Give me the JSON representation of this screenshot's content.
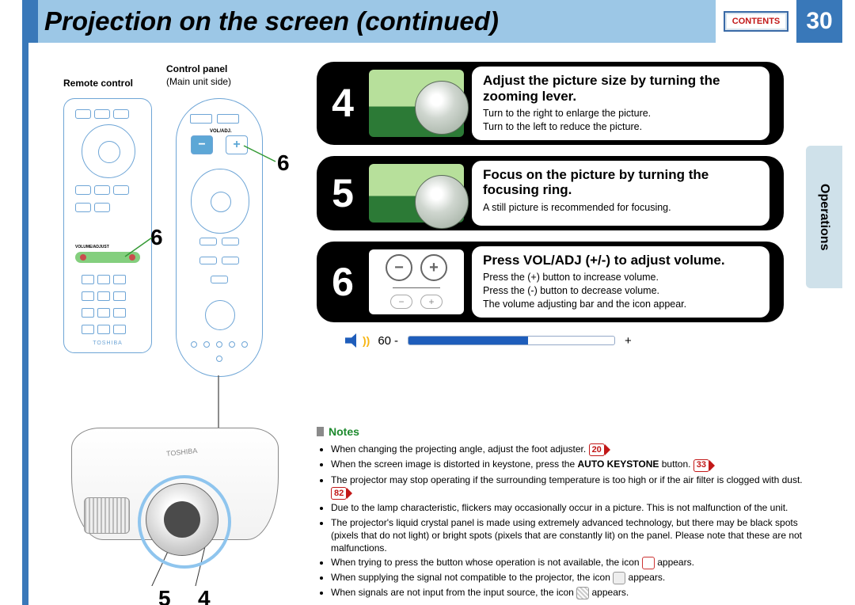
{
  "header": {
    "title": "Projection on the screen (continued)",
    "contents_label": "CONTENTS",
    "page_number": "30"
  },
  "side_tab": "Operations",
  "left": {
    "remote_label": "Remote control",
    "panel_label": "Control panel",
    "panel_sub": "(Main unit side)",
    "logo": "TOSHIBA",
    "voladj_label": "VOLUME/ADJUST",
    "cp_voladj": "VOL/ADJ.",
    "callout_6a": "6",
    "callout_6b": "6",
    "proj_5": "5",
    "proj_4": "4"
  },
  "steps": {
    "s4": {
      "num": "4",
      "title": "Adjust the picture size by turning the zooming lever.",
      "line1": "Turn to the right to enlarge the picture.",
      "line2": "Turn to the left to reduce the picture."
    },
    "s5": {
      "num": "5",
      "title": "Focus on the picture by turning the focusing ring.",
      "line1": "A still picture is recommended for focusing."
    },
    "s6": {
      "num": "6",
      "title": "Press VOL/ADJ (+/-) to adjust volume.",
      "line1": "Press the (+) button to increase volume.",
      "line2": "Press the (-) button to decrease volume.",
      "line3": "The volume adjusting bar and the icon appear."
    }
  },
  "volume": {
    "value": "60",
    "minus": "-",
    "plus": "+",
    "percent": 58
  },
  "notes": {
    "heading": "Notes",
    "n1a": "When changing the projecting angle, adjust the foot adjuster.",
    "n1_ref": "20",
    "n2a": "When the screen image is distorted in keystone, press the ",
    "n2b": "AUTO KEYSTONE",
    "n2c": " button.",
    "n2_ref": "33",
    "n3a": "The projector may stop operating if the surrounding temperature is too high or if the air filter is clogged with dust.",
    "n3_ref": "82",
    "n4": "Due to the lamp characteristic, flickers may occasionally occur in a picture. This is not malfunction of the unit.",
    "n5": "The projector's liquid crystal panel is made using extremely advanced technology, but there may be black spots (pixels that do not light) or bright spots (pixels that are constantly lit) on the panel. Please note that these are not malfunctions.",
    "n6a": "When trying to press the button whose operation is not available, the icon ",
    "n6b": " appears.",
    "n7a": "When supplying the signal not compatible to the projector, the icon ",
    "n7b": " appears.",
    "n8a": "When signals are not input from the input source, the icon ",
    "n8b": " appears."
  }
}
